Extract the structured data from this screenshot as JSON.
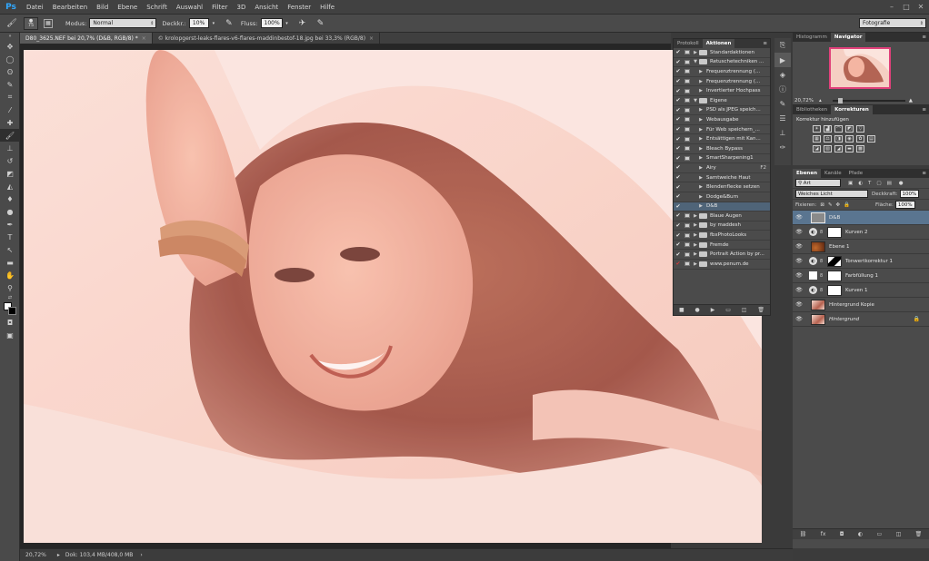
{
  "menubar": {
    "logo": "Ps",
    "items": [
      "Datei",
      "Bearbeiten",
      "Bild",
      "Ebene",
      "Schrift",
      "Auswahl",
      "Filter",
      "3D",
      "Ansicht",
      "Fenster",
      "Hilfe"
    ]
  },
  "options": {
    "brush_size": "75",
    "mode_label": "Modus:",
    "mode_value": "Normal",
    "opacity_label": "Deckkr.:",
    "opacity_value": "10%",
    "flow_label": "Fluss:",
    "flow_value": "100%",
    "workspace_value": "Fotografie"
  },
  "tabs": [
    {
      "label": "D80_3625.NEF bei 20,7% (D&B, RGB/8) *",
      "active": true
    },
    {
      "label": "© krolopgerst-leaks-flares-v6-flares-maddinbestof-18.jpg bei 33,3% (RGB/8)",
      "active": false
    }
  ],
  "status": {
    "zoom": "20,72%",
    "doc": "Dok: 103,4 MB/408,0 MB"
  },
  "actions_panel": {
    "tabs": [
      "Protokoll",
      "Aktionen"
    ],
    "active_tab": "Aktionen",
    "rows": [
      {
        "label": "Standardaktionen",
        "type": "set",
        "expanded": false,
        "check": "✔",
        "dialog": true
      },
      {
        "label": "Retuschetechniken ...",
        "type": "set",
        "expanded": true,
        "check": "✔",
        "dialog": true
      },
      {
        "label": "Frequenztrennung (...",
        "type": "action",
        "check": "✔",
        "dialog": true
      },
      {
        "label": "Frequenztrennung (...",
        "type": "action",
        "check": "✔",
        "dialog": true
      },
      {
        "label": "Invertierter Hochpass",
        "type": "action",
        "check": "✔",
        "dialog": true
      },
      {
        "label": "Eigene",
        "type": "set",
        "expanded": true,
        "check": "✔",
        "dialog": true
      },
      {
        "label": "PSD als JPEG speich...",
        "type": "action",
        "check": "✔",
        "dialog": true
      },
      {
        "label": "Webausgabe",
        "type": "action",
        "check": "✔",
        "dialog": true
      },
      {
        "label": "Für Web speichern_...",
        "type": "action",
        "check": "✔",
        "dialog": true
      },
      {
        "label": "Entsättigen mit Kan...",
        "type": "action",
        "check": "✔",
        "dialog": true
      },
      {
        "label": "Bleach Bypass",
        "type": "action",
        "check": "✔",
        "dialog": true
      },
      {
        "label": "SmartSharpening1",
        "type": "action",
        "check": "✔",
        "dialog": true
      },
      {
        "label": "Airy",
        "type": "action",
        "check": "✔",
        "dialog": false,
        "key": "F2"
      },
      {
        "label": "Samtweiche Haut",
        "type": "action",
        "check": "✔",
        "dialog": false
      },
      {
        "label": "Blendenflecke setzen",
        "type": "action",
        "check": "✔",
        "dialog": false
      },
      {
        "label": "Dodge&Burn",
        "type": "action",
        "check": "✔",
        "dialog": false
      },
      {
        "label": "D&B",
        "type": "action",
        "check": "✔",
        "dialog": false,
        "selected": true
      },
      {
        "label": "Blaue Augen",
        "type": "set",
        "expanded": false,
        "check": "✔",
        "dialog": true
      },
      {
        "label": "by maddesh",
        "type": "set",
        "expanded": false,
        "check": "✔",
        "dialog": true
      },
      {
        "label": "fbxPhotoLooks",
        "type": "set",
        "expanded": false,
        "check": "✔",
        "dialog": true
      },
      {
        "label": "Fremde",
        "type": "set",
        "expanded": false,
        "check": "✔",
        "dialog": true
      },
      {
        "label": "Portrait Action by pr...",
        "type": "set",
        "expanded": false,
        "check": "✔",
        "dialog": true
      },
      {
        "label": "www.penum.de",
        "type": "set",
        "expanded": false,
        "check": "✔",
        "check_red": true,
        "dialog": true
      }
    ]
  },
  "navigator": {
    "tabs": [
      "Histogramm",
      "Navigator"
    ],
    "active_tab": "Navigator",
    "zoom": "20,72%"
  },
  "adjustments": {
    "tabs": [
      "Bibliotheken",
      "Korrekturen"
    ],
    "active_tab": "Korrekturen",
    "title": "Korrektur hinzufügen"
  },
  "layers": {
    "tabs": [
      "Ebenen",
      "Kanäle",
      "Pfade"
    ],
    "active_tab": "Ebenen",
    "filter_value": "Art",
    "blend_value": "Weiches Licht",
    "opacity_label": "Deckkraft:",
    "opacity_value": "100%",
    "fix_label": "Fixieren:",
    "fill_label": "Fläche:",
    "fill_value": "100%",
    "rows": [
      {
        "name": "D&B",
        "kind": "pixel-gray",
        "selected": true
      },
      {
        "name": "Kurven 2",
        "kind": "adjust",
        "adj": "◐",
        "mask": "white"
      },
      {
        "name": "Ebene 1",
        "kind": "pixel-brown"
      },
      {
        "name": "Tonwertkorrektur 1",
        "kind": "adjust",
        "adj": "◐",
        "mask": "black-shape"
      },
      {
        "name": "Farbfüllung 1",
        "kind": "adjust",
        "adj": "■",
        "mask": "white"
      },
      {
        "name": "Kurven 1",
        "kind": "adjust",
        "adj": "◐",
        "mask": "white"
      },
      {
        "name": "Hintergrund Kopie",
        "kind": "photo"
      },
      {
        "name": "Hintergrund",
        "kind": "photo",
        "italic": true,
        "locked": true
      }
    ]
  }
}
